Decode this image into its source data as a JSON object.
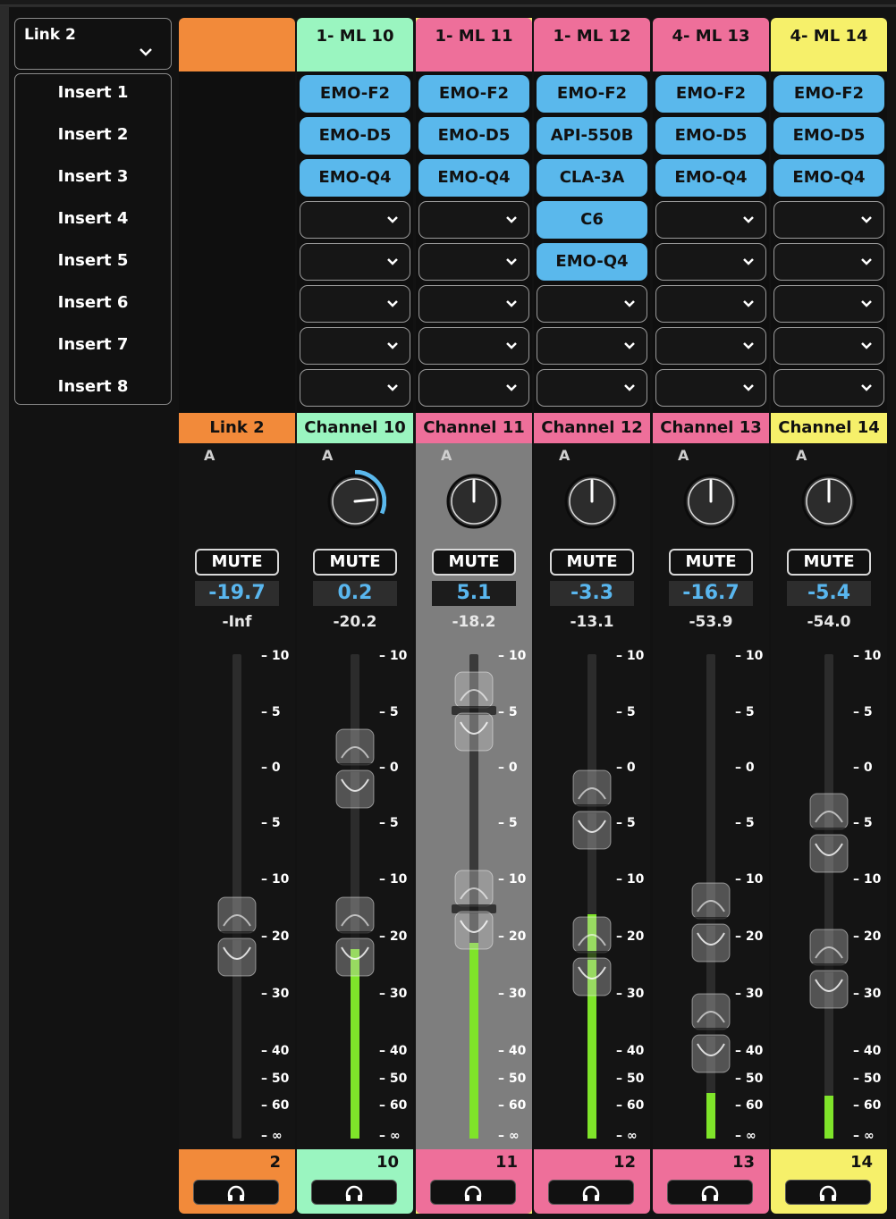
{
  "link_select": {
    "label": "Link 2"
  },
  "inserts": [
    "Insert 1",
    "Insert 2",
    "Insert 3",
    "Insert 4",
    "Insert 5",
    "Insert 6",
    "Insert 7",
    "Insert 8"
  ],
  "scale": [
    "10",
    "5",
    "0",
    "5",
    "10",
    "20",
    "30",
    "40",
    "50",
    "60",
    "∞"
  ],
  "strips": [
    {
      "header": "",
      "name": "Link 2",
      "label_a": "A",
      "mute": "MUTE",
      "gain": "-19.7",
      "peak": "-Inf",
      "number": "2",
      "color": "#f28a3a",
      "knob": false,
      "inserts": [],
      "empty_slots": 0,
      "meter_db": null
    },
    {
      "header": "1- ML 10",
      "name": "Channel 10",
      "label_a": "A",
      "mute": "MUTE",
      "gain": "0.2",
      "peak": "-20.2",
      "number": "10",
      "color": "#9af5c0",
      "knob": true,
      "knob_ring": true,
      "inserts": [
        "EMO-F2",
        "EMO-D5",
        "EMO-Q4"
      ],
      "empty_slots": 5,
      "meter_db": -22
    },
    {
      "header": "1- ML 11",
      "name": "Channel 11",
      "label_a": "A",
      "mute": "MUTE",
      "gain": "5.1",
      "peak": "-18.2",
      "number": "11",
      "color": "#ee6f9a",
      "knob": true,
      "knob_ring": false,
      "selected": true,
      "inserts": [
        "EMO-F2",
        "EMO-D5",
        "EMO-Q4"
      ],
      "empty_slots": 5,
      "meter_db": -21
    },
    {
      "header": "1- ML 12",
      "name": "Channel 12",
      "label_a": "A",
      "mute": "MUTE",
      "gain": "-3.3",
      "peak": "-13.1",
      "number": "12",
      "color": "#ee6f9a",
      "knob": true,
      "knob_ring": false,
      "inserts": [
        "EMO-F2",
        "API-550B",
        "CLA-3A",
        "C6",
        "EMO-Q4"
      ],
      "empty_slots": 3,
      "meter_db": -16
    },
    {
      "header": "4- ML 13",
      "name": "Channel 13",
      "label_a": "A",
      "mute": "MUTE",
      "gain": "-16.7",
      "peak": "-53.9",
      "number": "13",
      "color": "#ee6f9a",
      "knob": true,
      "knob_ring": false,
      "inserts": [
        "EMO-F2",
        "EMO-D5",
        "EMO-Q4"
      ],
      "empty_slots": 5,
      "meter_db": -55
    },
    {
      "header": "4- ML 14",
      "name": "Channel 14",
      "label_a": "A",
      "mute": "MUTE",
      "gain": "-5.4",
      "peak": "-54.0",
      "number": "14",
      "color": "#f6f06a",
      "knob": true,
      "knob_ring": false,
      "inserts": [
        "EMO-F2",
        "EMO-D5",
        "EMO-Q4"
      ],
      "empty_slots": 5,
      "meter_db": -56
    }
  ]
}
